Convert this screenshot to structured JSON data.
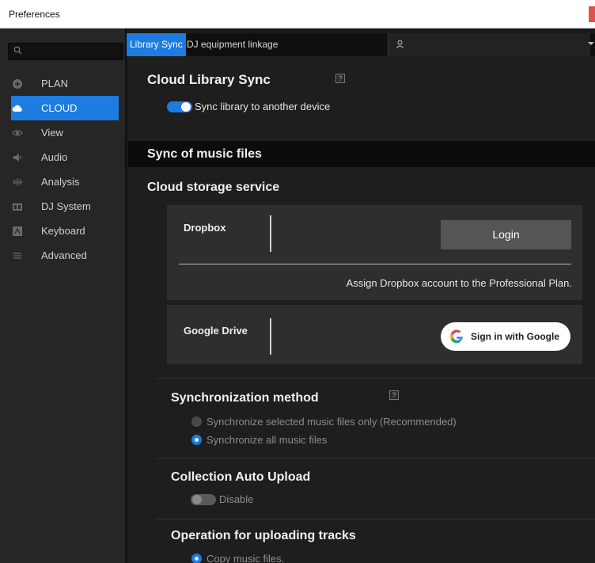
{
  "window": {
    "title": "Preferences"
  },
  "sidebar": {
    "search_placeholder": "",
    "items": [
      {
        "label": "PLAN",
        "icon": "plan-icon",
        "active": false
      },
      {
        "label": "CLOUD",
        "icon": "cloud-icon",
        "active": true
      },
      {
        "label": "View",
        "icon": "eye-icon",
        "active": false
      },
      {
        "label": "Audio",
        "icon": "speaker-icon",
        "active": false
      },
      {
        "label": "Analysis",
        "icon": "waveform-icon",
        "active": false
      },
      {
        "label": "DJ System",
        "icon": "dj-system-icon",
        "active": false
      },
      {
        "label": "Keyboard",
        "icon": "keyboard-icon",
        "active": false
      },
      {
        "label": "Advanced",
        "icon": "menu-icon",
        "active": false
      }
    ]
  },
  "tabs": [
    {
      "label": "Library Sync",
      "active": true
    },
    {
      "label": "DJ equipment linkage",
      "active": false
    }
  ],
  "cloud_library_sync": {
    "title": "Cloud Library Sync",
    "help": "?",
    "toggle_label": "Sync library to another device",
    "toggle_on": true
  },
  "sync_music_files": {
    "title": "Sync of music files"
  },
  "cloud_storage": {
    "title": "Cloud storage service",
    "dropbox": {
      "name": "Dropbox",
      "login_label": "Login",
      "assign_text": "Assign Dropbox account to the Professional Plan."
    },
    "google_drive": {
      "name": "Google Drive",
      "signin_label": "Sign in with Google"
    }
  },
  "sync_method": {
    "title": "Synchronization method",
    "help": "?",
    "options": [
      {
        "label": "Synchronize selected music files only (Recommended)",
        "selected": false
      },
      {
        "label": "Synchronize all music files",
        "selected": true
      }
    ]
  },
  "auto_upload": {
    "title": "Collection Auto Upload",
    "toggle_label": "Disable",
    "toggle_on": false
  },
  "upload_op": {
    "title": "Operation for uploading tracks",
    "option_label": "Copy music files."
  },
  "colors": {
    "accent": "#1e7be0",
    "background": "#1e1e1e",
    "sidebar": "#262626"
  }
}
